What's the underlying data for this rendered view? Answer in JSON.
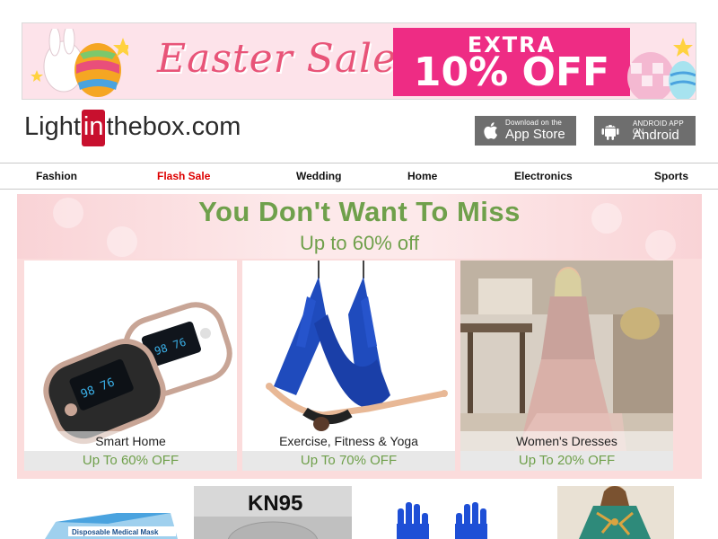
{
  "banner": {
    "title": "Easter Sale",
    "extra_label": "EXTRA",
    "offer": "10% OFF",
    "colors": {
      "background": "#fde3ea",
      "title": "#e85478",
      "offer_box": "#ee2c84"
    }
  },
  "header": {
    "logo": {
      "part1": "Light",
      "part2": "in",
      "part3": "thebox.com"
    },
    "app_store": {
      "small": "Download on the",
      "big": "App Store",
      "icon": "apple-icon"
    },
    "android": {
      "small": "ANDROID APP ON",
      "big": "Android",
      "icon": "android-icon"
    }
  },
  "nav": {
    "items": [
      {
        "label": "Fashion"
      },
      {
        "label": "Flash Sale",
        "highlight": true
      },
      {
        "label": "Wedding"
      },
      {
        "label": "Home"
      },
      {
        "label": "Electronics"
      },
      {
        "label": "Sports"
      }
    ],
    "highlight_color": "#dd0000"
  },
  "promo": {
    "title": "You Don't Want To Miss",
    "subtitle": "Up to 60% off",
    "accent_color": "#6fa04b",
    "cards": [
      {
        "label": "Smart Home",
        "discount": "Up To 60% OFF"
      },
      {
        "label": "Exercise, Fitness & Yoga",
        "discount": "Up To 70% OFF"
      },
      {
        "label": "Women's Dresses",
        "discount": "Up To 20% OFF"
      }
    ]
  },
  "products": {
    "mask_box_text": "Disposable Medical Mask",
    "kn95_text": "KN95"
  }
}
